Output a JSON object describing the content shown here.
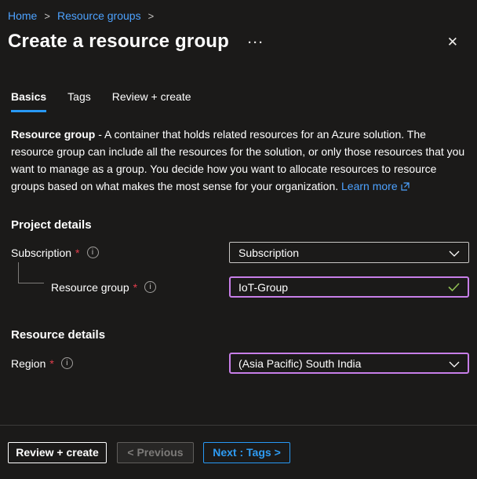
{
  "colors": {
    "background": "#1b1a19",
    "link_blue": "#4da2ff",
    "tab_underline_blue": "#2899f5",
    "purple_field_border": "#c77ee8",
    "valid_green": "#8fbe53",
    "required_red": "#e23d4c"
  },
  "breadcrumb": {
    "items": [
      "Home",
      "Resource groups"
    ],
    "separator": ">"
  },
  "header": {
    "title": "Create a resource group",
    "more_glyph": "···",
    "close_glyph": "✕"
  },
  "tabs": [
    {
      "label": "Basics",
      "active": true
    },
    {
      "label": "Tags",
      "active": false
    },
    {
      "label": "Review + create",
      "active": false
    }
  ],
  "description": {
    "lead": "Resource group",
    "body": " - A container that holds related resources for an Azure solution. The resource group can include all the resources for the solution, or only those resources that you want to manage as a group. You decide how you want to allocate resources to resource groups based on what makes the most sense for your organization. ",
    "link_label": "Learn more"
  },
  "sections": {
    "project_details": "Project details",
    "resource_details": "Resource details"
  },
  "fields": {
    "subscription": {
      "label": "Subscription",
      "required_mark": "*",
      "value": "Subscription"
    },
    "resource_group": {
      "label": "Resource group",
      "required_mark": "*",
      "value": "IoT-Group"
    },
    "region": {
      "label": "Region",
      "required_mark": "*",
      "value": "(Asia Pacific) South India"
    }
  },
  "icons": {
    "info_glyph": "i"
  },
  "footer": {
    "review_create_label": "Review + create",
    "previous_label": "< Previous",
    "next_label": "Next : Tags >"
  }
}
